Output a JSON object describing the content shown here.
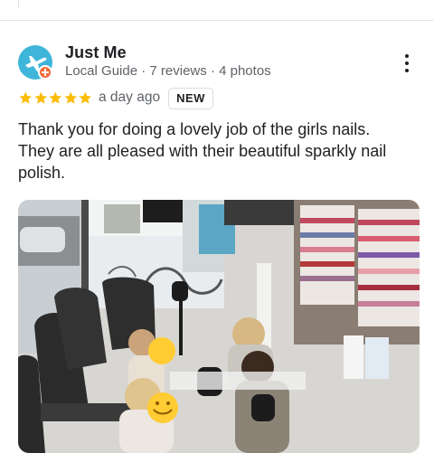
{
  "review": {
    "author_name": "Just Me",
    "author_meta": {
      "badge": "Local Guide",
      "reviews": "7 reviews",
      "photos": "4 photos",
      "separator": "·"
    },
    "rating": 5,
    "max_rating": 5,
    "age": "a day ago",
    "new_badge": "NEW",
    "text": "Thank you for doing a lovely job of the girls nails. They are all pleased with their beautiful sparkly nail polish."
  },
  "icons": {
    "avatar": "airplane-avatar-icon",
    "guide_badge": "local-guide-badge-icon",
    "star": "star-icon",
    "menu": "more-vert-icon"
  },
  "colors": {
    "avatar_bg": "#3fb6d9",
    "guide_badge": "#f26b3a",
    "star": "#fbbc04",
    "text_primary": "#202124",
    "text_secondary": "#5f6368"
  }
}
